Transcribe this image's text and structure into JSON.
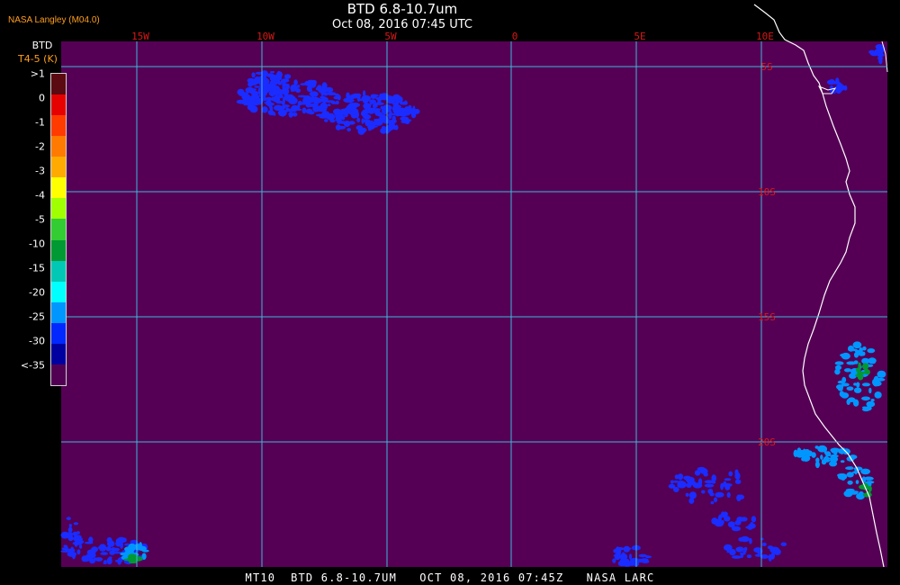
{
  "header": {
    "org": "NASA Langley (M04.0)",
    "title": "BTD 6.8-10.7um",
    "subtitle": "Oct 08, 2016 07:45 UTC"
  },
  "footer": {
    "caption": "MT10  BTD 6.8-10.7UM   OCT 08, 2016 07:45Z   NASA LARC"
  },
  "legend": {
    "title": "BTD",
    "unit": "T4-5 (K)",
    "labels": [
      ">1",
      "0",
      "-1",
      "-2",
      "-3",
      "-4",
      "-5",
      "-10",
      "-15",
      "-20",
      "-25",
      "-30",
      "<-35"
    ],
    "swatches": [
      "#5a0a10",
      "#e60000",
      "#ff3b00",
      "#ff7a00",
      "#ffaa00",
      "#ffff00",
      "#a0ff00",
      "#33cc33",
      "#009933",
      "#00c8b4",
      "#00ffff",
      "#0096ff",
      "#0028ff",
      "#0000a0",
      "#520054"
    ]
  },
  "map": {
    "background_color": "#550055",
    "grid_color": "#3fb8d8",
    "grid_label_color": "#d81818",
    "coast_color": "#ffffff",
    "cloud_color": "#1a2cff",
    "lon_labels": [
      "15W",
      "10W",
      "5W",
      "0",
      "5E",
      "10E"
    ],
    "lat_labels": [
      "5S",
      "10S",
      "15S",
      "20S"
    ]
  }
}
